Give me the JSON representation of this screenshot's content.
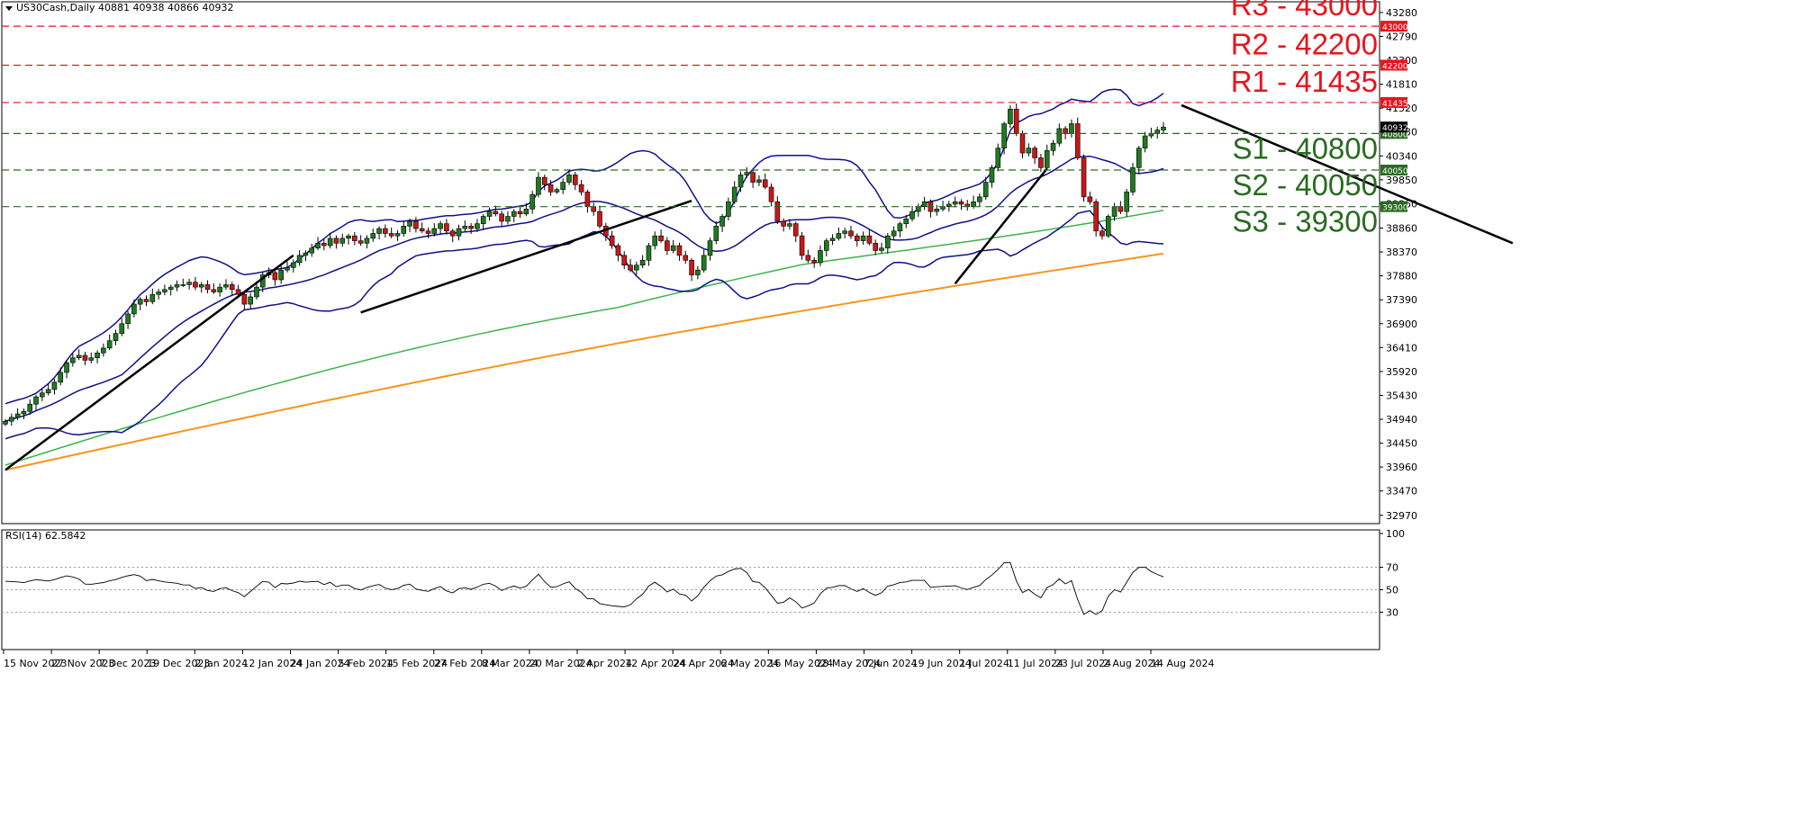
{
  "header": {
    "symbol_line": "US30Cash,Daily  40881 40938 40866 40932",
    "rsi_label": "RSI(14) 62.5842"
  },
  "colors": {
    "resistance": "#e8141e",
    "support": "#2a6b22",
    "candle_up": "#1f7a1f",
    "candle_down": "#c81818",
    "bollinger": "#10108a",
    "ma_100": "#3bb54a",
    "ma_200": "#f7941d",
    "trendline": "#000000"
  },
  "chart_data": {
    "type": "candlestick",
    "title": "US30Cash,Daily",
    "ohlc_readout": [
      40881,
      40938,
      40866,
      40932
    ],
    "last_price": 40932,
    "ylim": [
      32800,
      43500
    ],
    "y_ticks": [
      43280,
      42790,
      42300,
      41810,
      41320,
      40830,
      40340,
      39850,
      39360,
      38860,
      38370,
      37880,
      37390,
      36900,
      36410,
      35920,
      35430,
      34940,
      34450,
      33960,
      33470,
      32970
    ],
    "x_ticks": [
      "15 Nov 2023",
      "27 Nov 2023",
      "7 Dec 2023",
      "19 Dec 2023",
      "2 Jan 2024",
      "12 Jan 2024",
      "24 Jan 2024",
      "5 Feb 2024",
      "15 Feb 2024",
      "27 Feb 2024",
      "8 Mar 2024",
      "20 Mar 2024",
      "2 Apr 2024",
      "12 Apr 2024",
      "24 Apr 2024",
      "6 May 2024",
      "16 May 2024",
      "28 May 2024",
      "7 Jun 2024",
      "19 Jun 2024",
      "1 Jul 2024",
      "11 Jul 2024",
      "23 Jul 2024",
      "2 Aug 2024",
      "14 Aug 2024"
    ],
    "levels": [
      {
        "label": "R3 - 43000",
        "value": 43000,
        "tag": "43000",
        "kind": "resistance"
      },
      {
        "label": "R2 - 42200",
        "value": 42200,
        "tag": "42200",
        "kind": "resistance"
      },
      {
        "label": "R1 - 41435",
        "value": 41435,
        "tag": "41435",
        "kind": "resistance"
      },
      {
        "label": "S1 - 40800",
        "value": 40800,
        "tag": "40800",
        "kind": "support"
      },
      {
        "label": "S2 - 40050",
        "value": 40050,
        "tag": "40050",
        "kind": "support"
      },
      {
        "label": "S3 - 39300",
        "value": 39300,
        "tag": "39300",
        "kind": "support"
      }
    ],
    "closes": [
      34900,
      34980,
      35050,
      35100,
      35250,
      35400,
      35480,
      35550,
      35700,
      35900,
      36100,
      36200,
      36250,
      36150,
      36200,
      36300,
      36400,
      36550,
      36700,
      36900,
      37100,
      37300,
      37400,
      37350,
      37500,
      37550,
      37600,
      37650,
      37700,
      37700,
      37750,
      37650,
      37700,
      37600,
      37550,
      37650,
      37700,
      37600,
      37500,
      37300,
      37450,
      37650,
      37900,
      37950,
      37800,
      38000,
      38050,
      38150,
      38300,
      38350,
      38450,
      38550,
      38500,
      38650,
      38550,
      38650,
      38700,
      38600,
      38550,
      38650,
      38750,
      38850,
      38750,
      38700,
      38750,
      38900,
      39000,
      38850,
      38800,
      38750,
      38850,
      38950,
      38800,
      38700,
      38850,
      38900,
      38850,
      38950,
      39100,
      39200,
      39150,
      39000,
      39100,
      39200,
      39150,
      39250,
      39550,
      39900,
      39750,
      39600,
      39650,
      39800,
      39950,
      39750,
      39600,
      39300,
      39200,
      38900,
      38700,
      38500,
      38300,
      38100,
      38000,
      38100,
      38200,
      38500,
      38700,
      38600,
      38400,
      38500,
      38300,
      38200,
      37900,
      38000,
      38300,
      38600,
      38900,
      39100,
      39400,
      39700,
      39950,
      40000,
      39800,
      39850,
      39700,
      39400,
      39000,
      38900,
      38950,
      38700,
      38300,
      38200,
      38150,
      38400,
      38600,
      38650,
      38750,
      38800,
      38700,
      38600,
      38700,
      38550,
      38400,
      38450,
      38700,
      38800,
      38950,
      39050,
      39200,
      39300,
      39400,
      39200,
      39250,
      39300,
      39350,
      39400,
      39350,
      39300,
      39400,
      39500,
      39800,
      40100,
      40500,
      41000,
      41300,
      40800,
      40400,
      40500,
      40300,
      40100,
      40450,
      40600,
      40900,
      40800,
      41000,
      40300,
      39500,
      39400,
      38800,
      38700,
      39100,
      39300,
      39200,
      39600,
      40100,
      40500,
      40750,
      40800,
      40870,
      40932
    ],
    "rsi": {
      "label": "RSI(14)",
      "value": 62.5842,
      "levels": [
        70,
        50,
        30
      ],
      "range": [
        0,
        100
      ]
    }
  }
}
